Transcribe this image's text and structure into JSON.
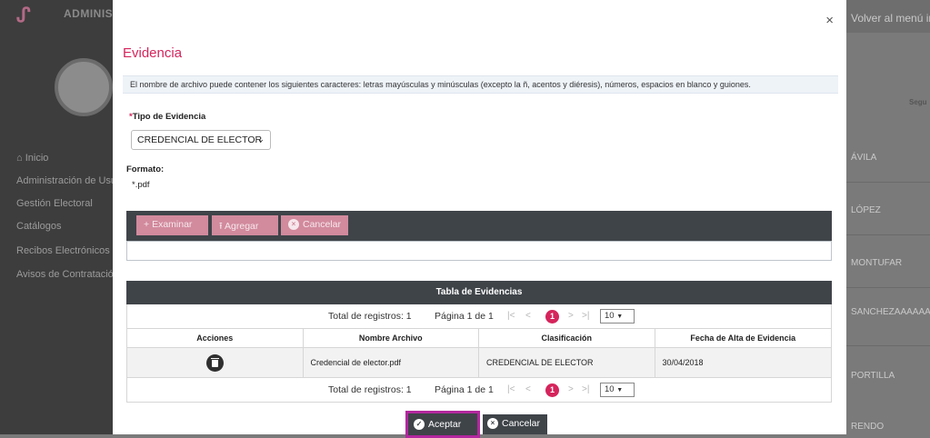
{
  "background": {
    "app_title": "ADMINISTR",
    "top_right_link": "Volver al menú ini",
    "nav": [
      "Inicio",
      "Administración de Usua",
      "Gestión Electoral",
      "Catálogos",
      "Recibos Electrónicos",
      "Avisos de Contratación"
    ],
    "right_col_header": "Segu",
    "right_col_names": [
      "ÁVILA",
      "LÓPEZ",
      "MONTUFAR",
      "SANCHEZAAAAAAAAAAA",
      "PORTILLA",
      "RENDO"
    ]
  },
  "modal": {
    "close": "×",
    "title": "Evidencia",
    "info": "El nombre de archivo puede contener los siguientes caracteres: letras mayúsculas y minúsculas (excepto la ñ, acentos y diéresis), números, espacios en blanco y guiones.",
    "tipo_label_req": "*",
    "tipo_label": "Tipo de Evidencia",
    "tipo_value": "CREDENCIAL DE ELECTOR",
    "formato_label": "Formato:",
    "formato_value": "*.pdf",
    "upload": {
      "examinar": "Examinar",
      "agregar": "Agregar",
      "cancelar": "Cancelar"
    },
    "table": {
      "title": "Tabla de Evidencias",
      "total": "Total de registros: 1",
      "page": "Página 1 de 1",
      "current_page": "1",
      "page_size": "10",
      "headers": [
        "Acciones",
        "Nombre Archivo",
        "Clasificación",
        "Fecha de Alta de Evidencia"
      ],
      "rows": [
        {
          "nombre": "Credencial de elector.pdf",
          "clasificacion": "CREDENCIAL DE ELECTOR",
          "fecha": "30/04/2018"
        }
      ]
    },
    "buttons": {
      "accept": "Aceptar",
      "cancel": "Cancelar"
    }
  },
  "colors": {
    "accent": "#d5245c",
    "dark": "#3f4449",
    "highlight": "#b3279e"
  }
}
